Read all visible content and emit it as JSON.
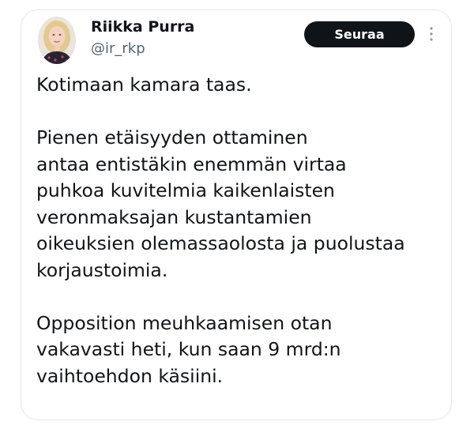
{
  "tweet": {
    "author": {
      "name": "Riikka Purra",
      "handle": "@ir_rkp",
      "avatar": "profile-photo"
    },
    "follow_label": "Seuraa",
    "more_icon": "more-dots-icon",
    "paragraphs": [
      {
        "lines": [
          "Kotimaan kamara taas."
        ]
      },
      {
        "lines": [
          "Pienen etäisyyden ottaminen",
          "antaa entistäkin enemmän virtaa",
          "puhkoa kuvitelmia kaikenlaisten",
          "veronmaksajan kustantamien",
          "oikeuksien olemassaolosta ja puolustaa",
          "korjaustoimia."
        ]
      },
      {
        "lines": [
          "Opposition meuhkaamisen otan",
          "vakavasti heti, kun saan 9 mrd:n",
          "vaihtoehdon käsiini."
        ]
      }
    ],
    "colors": {
      "text": "#0f1419",
      "secondary": "#536471",
      "button_bg": "#0f1419",
      "button_text": "#ffffff",
      "border": "#e3e6e9"
    }
  }
}
